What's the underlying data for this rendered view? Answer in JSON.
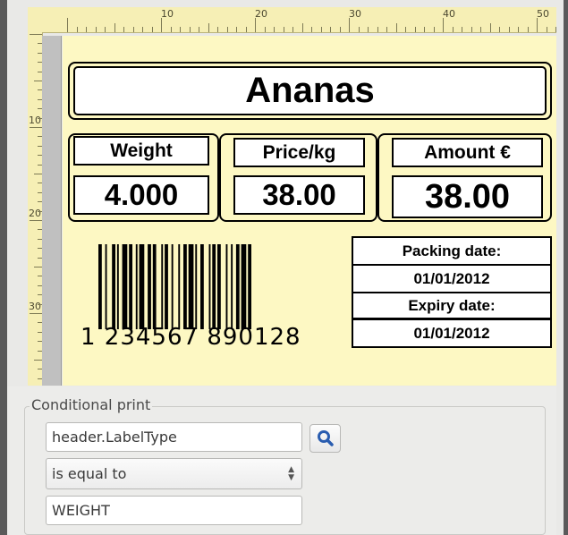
{
  "ruler": {
    "top_labels": [
      "10",
      "20",
      "30",
      "40",
      "50"
    ],
    "left_labels": [
      "10",
      "20",
      "30"
    ]
  },
  "label": {
    "title": "Ananas",
    "weight_header": "Weight",
    "weight_value": "4.000",
    "price_header": "Price/kg",
    "price_value": "38.00",
    "amount_header": "Amount €",
    "amount_value": "38.00",
    "barcode_digits": "1 234567 890128",
    "packing_label": "Packing date:",
    "packing_value": "01/01/2012",
    "expiry_label": "Expiry date:",
    "expiry_value": "01/01/2012"
  },
  "conditional_print": {
    "group_title": "Conditional print",
    "field_value": "header.LabelType",
    "operator_value": "is equal to",
    "compare_value": "WEIGHT"
  },
  "icons": {
    "search": "magnifier-icon",
    "spinner": "up-down-arrows-icon"
  },
  "colors": {
    "canvas": "#fdf8c3",
    "ruler": "#f6efb5",
    "search_accent": "#2a5db0"
  }
}
